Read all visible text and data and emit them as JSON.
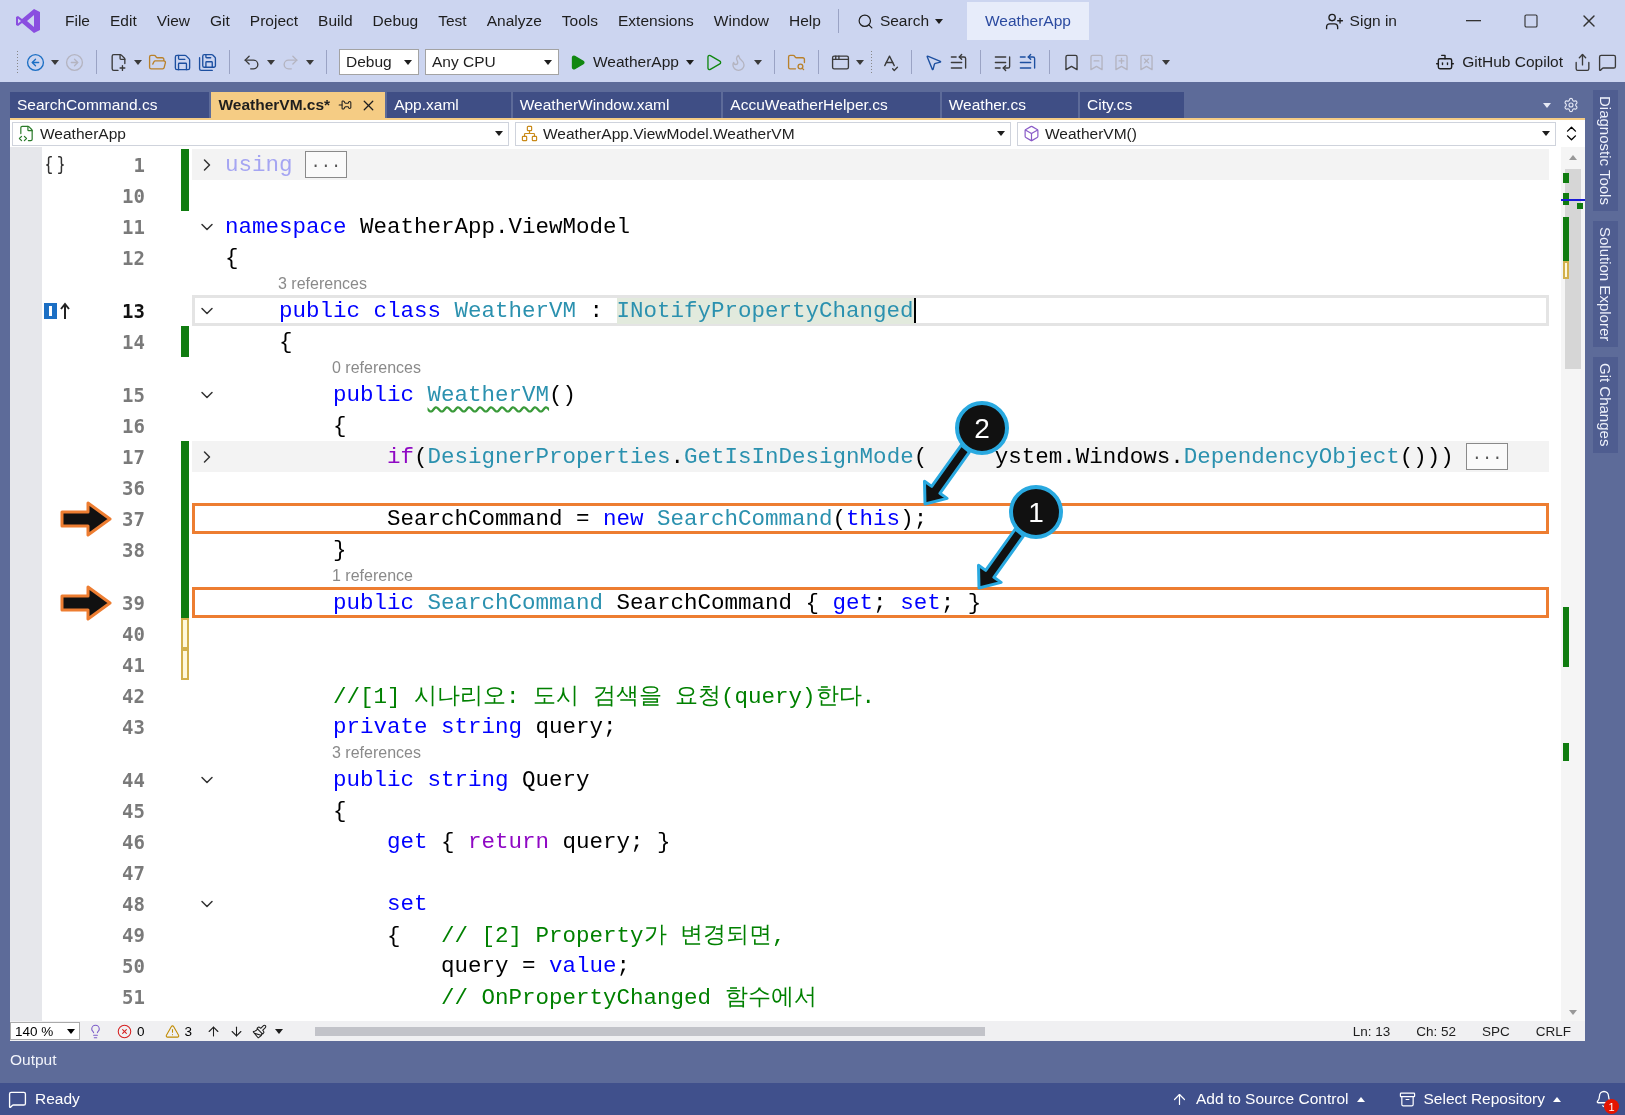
{
  "menu_bar": {
    "items": [
      "File",
      "Edit",
      "View",
      "Git",
      "Project",
      "Build",
      "Debug",
      "Test",
      "Analyze",
      "Tools",
      "Extensions",
      "Window",
      "Help"
    ],
    "search": "Search",
    "solution": "WeatherApp",
    "sign_in": "Sign in"
  },
  "toolbar": {
    "configuration": "Debug",
    "platform": "Any CPU",
    "startup": "WeatherApp",
    "copilot": "GitHub Copilot"
  },
  "tabs": [
    {
      "label": "SearchCommand.cs",
      "selected": false
    },
    {
      "label": "WeatherVM.cs*",
      "selected": true
    },
    {
      "label": "App.xaml",
      "selected": false
    },
    {
      "label": "WeatherWindow.xaml",
      "selected": false
    },
    {
      "label": "AccuWeatherHelper.cs",
      "selected": false
    },
    {
      "label": "Weather.cs",
      "selected": false
    },
    {
      "label": "City.cs",
      "selected": false
    }
  ],
  "navigation": {
    "project": "WeatherApp",
    "type": "WeatherApp.ViewModel.WeatherVM",
    "member": "WeatherVM()"
  },
  "code_lines": [
    {
      "number": "1",
      "glyph": {
        "kind": "scope"
      },
      "expanded": false,
      "color": "#107c10",
      "current": false,
      "marked": false,
      "highlighted": false,
      "tokens": [
        {
          "kind": "faded",
          "text": "using"
        },
        {
          "kind": "more",
          "text": "..."
        }
      ]
    },
    {
      "number": "10",
      "color": "#107c10",
      "current": false,
      "marked": false,
      "highlighted": false
    },
    {
      "number": "11",
      "expanded": true,
      "current": false,
      "marked": false,
      "highlighted": false,
      "tokens": [
        {
          "kind": "keyword",
          "text": "namespace"
        },
        {
          "kind": "plain",
          "text": " WeatherApp.ViewModel"
        }
      ]
    },
    {
      "number": "12",
      "current": false,
      "marked": false,
      "highlighted": false,
      "tokens": [
        {
          "kind": "plain",
          "text": "{"
        }
      ]
    },
    {
      "number": "13",
      "glyph": {
        "kind": "implements"
      },
      "expanded": true,
      "codelens": "3 references",
      "current": true,
      "marked": false,
      "highlighted": false,
      "tokens": [
        {
          "kind": "keyword",
          "text": "    public class"
        },
        {
          "kind": "type",
          "text": " WeatherVM"
        },
        {
          "kind": "plain",
          "text": " : "
        },
        {
          "kind": "highlight",
          "text": "INotifyPropertyChanged"
        }
      ]
    },
    {
      "number": "14",
      "color": "#107c10",
      "current": false,
      "marked": false,
      "highlighted": false,
      "tokens": [
        {
          "kind": "plain",
          "text": "    {"
        }
      ]
    },
    {
      "number": "15",
      "expanded": true,
      "codelens": "0 references",
      "current": false,
      "marked": false,
      "highlighted": false,
      "tokens": [
        {
          "kind": "keyword",
          "text": "        public "
        },
        {
          "kind": "squiggle",
          "text": "WeatherVM"
        },
        {
          "kind": "plain",
          "text": "()"
        }
      ]
    },
    {
      "number": "16",
      "current": false,
      "marked": false,
      "highlighted": false,
      "tokens": [
        {
          "kind": "plain",
          "text": "        {"
        }
      ]
    },
    {
      "number": "17",
      "expanded": false,
      "color": "#107c10",
      "current": false,
      "marked": false,
      "highlighted": false,
      "tokens": [
        {
          "kind": "control",
          "text": "            if"
        },
        {
          "kind": "plain",
          "text": "("
        },
        {
          "kind": "type",
          "text": "DesignerProperties"
        },
        {
          "kind": "plain",
          "text": "."
        },
        {
          "kind": "type",
          "text": "GetIsInDesignMode"
        },
        {
          "kind": "plain",
          "text": "("
        },
        {
          "kind": "hidden"
        },
        {
          "kind": "plain",
          "text": "ystem.Windows."
        },
        {
          "kind": "type",
          "text": "DependencyObject"
        },
        {
          "kind": "plain",
          "text": "()))"
        },
        {
          "kind": "more",
          "text": "..."
        }
      ]
    },
    {
      "number": "36",
      "color": "#107c10",
      "current": false,
      "marked": false,
      "highlighted": false
    },
    {
      "number": "37",
      "color": "#107c10",
      "current": false,
      "marked": true,
      "highlighted": true,
      "callout": "2",
      "tokens": [
        {
          "kind": "plain",
          "text": "            SearchCommand = "
        },
        {
          "kind": "keyword",
          "text": "new"
        },
        {
          "kind": "type",
          "text": " SearchCommand"
        },
        {
          "kind": "plain",
          "text": "("
        },
        {
          "kind": "keyword",
          "text": "this"
        },
        {
          "kind": "plain",
          "text": ");"
        }
      ]
    },
    {
      "number": "38",
      "color": "#107c10",
      "current": false,
      "marked": false,
      "highlighted": false,
      "tokens": [
        {
          "kind": "plain",
          "text": "        }"
        }
      ]
    },
    {
      "number": "39",
      "color": "#107c10",
      "codelens": "1 reference",
      "current": false,
      "marked": true,
      "highlighted": true,
      "callout": "1",
      "tokens": [
        {
          "kind": "keyword",
          "text": "        public"
        },
        {
          "kind": "type",
          "text": " SearchCommand"
        },
        {
          "kind": "plain",
          "text": " SearchCommand { "
        },
        {
          "kind": "keyword",
          "text": "get"
        },
        {
          "kind": "plain",
          "text": "; "
        },
        {
          "kind": "keyword",
          "text": "set"
        },
        {
          "kind": "plain",
          "text": "; }"
        }
      ]
    },
    {
      "number": "40",
      "color": "#d2b04c",
      "current": false,
      "marked": false,
      "highlighted": false
    },
    {
      "number": "41",
      "color": "#d2b04c",
      "current": false,
      "marked": false,
      "highlighted": false
    },
    {
      "number": "42",
      "current": false,
      "marked": false,
      "highlighted": false,
      "tokens": [
        {
          "kind": "comment",
          "text": "        //[1] 시나리오: 도시 검색을 요청(query)한다."
        }
      ]
    },
    {
      "number": "43",
      "current": false,
      "marked": false,
      "highlighted": false,
      "tokens": [
        {
          "kind": "keyword",
          "text": "        private string"
        },
        {
          "kind": "plain",
          "text": " query;"
        }
      ]
    },
    {
      "number": "44",
      "expanded": true,
      "codelens": "3 references",
      "current": false,
      "marked": false,
      "highlighted": false,
      "tokens": [
        {
          "kind": "keyword",
          "text": "        public string"
        },
        {
          "kind": "plain",
          "text": " Query"
        }
      ]
    },
    {
      "number": "45",
      "current": false,
      "marked": false,
      "highlighted": false,
      "tokens": [
        {
          "kind": "plain",
          "text": "        {"
        }
      ]
    },
    {
      "number": "46",
      "current": false,
      "marked": false,
      "highlighted": false,
      "tokens": [
        {
          "kind": "keyword",
          "text": "            get"
        },
        {
          "kind": "plain",
          "text": " { "
        },
        {
          "kind": "control",
          "text": "return"
        },
        {
          "kind": "plain",
          "text": " query; }"
        }
      ]
    },
    {
      "number": "47",
      "current": false,
      "marked": false,
      "highlighted": false
    },
    {
      "number": "48",
      "expanded": true,
      "current": false,
      "marked": false,
      "highlighted": false,
      "tokens": [
        {
          "kind": "keyword",
          "text": "            set"
        }
      ]
    },
    {
      "number": "49",
      "current": false,
      "marked": false,
      "highlighted": false,
      "tokens": [
        {
          "kind": "plain",
          "text": "            {   "
        },
        {
          "kind": "comment",
          "text": "// [2] Property가 변경되면,"
        }
      ]
    },
    {
      "number": "50",
      "current": false,
      "marked": false,
      "highlighted": false,
      "tokens": [
        {
          "kind": "plain",
          "text": "                query = "
        },
        {
          "kind": "keyword",
          "text": "value"
        },
        {
          "kind": "plain",
          "text": ";"
        }
      ]
    },
    {
      "number": "51",
      "current": false,
      "marked": false,
      "highlighted": false,
      "tokens": [
        {
          "kind": "comment",
          "text": "                // OnPropertyChanged 함수에서"
        }
      ]
    }
  ],
  "editor_status": {
    "zoom": "140 %",
    "errors": "0",
    "warnings": "3",
    "line": "Ln: 13",
    "column": "Ch: 52",
    "indent": "SPC",
    "line_ending": "CRLF"
  },
  "side_tabs": [
    "Diagnostic Tools",
    "Solution Explorer",
    "Git Changes"
  ],
  "output_panel": {
    "title": "Output"
  },
  "status_bar": {
    "message": "Ready",
    "source_control": "Add to Source Control",
    "repository": "Select Repository",
    "notifications": "1"
  }
}
